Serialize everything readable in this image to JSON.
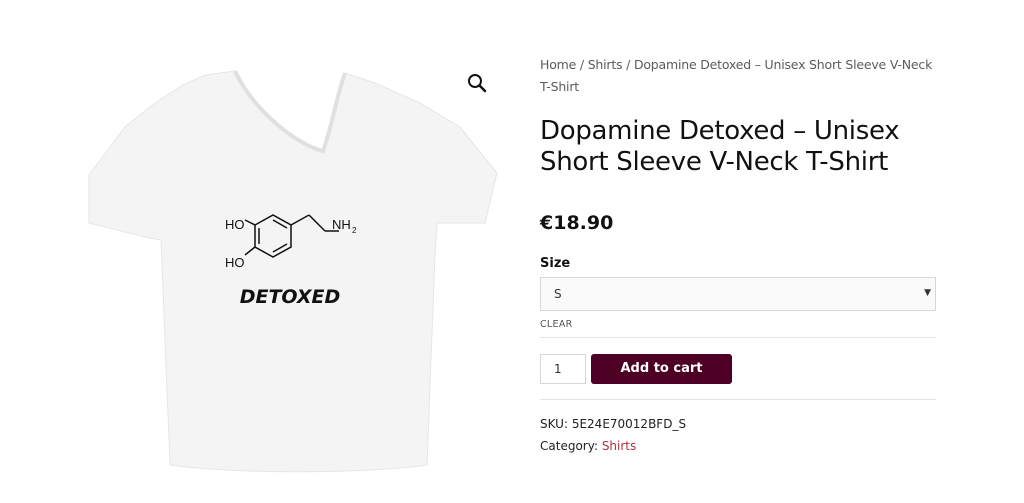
{
  "breadcrumb": {
    "home": "Home",
    "sep1": " / ",
    "shirts": "Shirts",
    "sep2": " / ",
    "current": "Dopamine Detoxed – Unisex Short Sleeve V-Neck T-Shirt"
  },
  "product": {
    "title": "Dopamine Detoxed – Unisex Short Sleeve V-Neck T-Shirt",
    "price": "€18.90",
    "image": {
      "shirt_color": "#f4f4f4",
      "print_text": "DETOXED",
      "molecule_labels": {
        "ho_top": "HO",
        "ho_bottom": "HO",
        "nh2": "NH",
        "sub2": "2"
      }
    }
  },
  "variation": {
    "size_label": "Size",
    "size_selected": "S",
    "arrow": "▼",
    "clear_label": "CLEAR"
  },
  "cart": {
    "quantity": "1",
    "add_label": "Add to cart",
    "button_color": "#4d0024"
  },
  "meta": {
    "sku_label": "SKU:",
    "sku_value": "5E24E70012BFD_S",
    "category_label": "Category:",
    "category_value": "Shirts",
    "link_color": "#b0303e"
  },
  "icons": {
    "zoom": "magnifier-icon"
  }
}
